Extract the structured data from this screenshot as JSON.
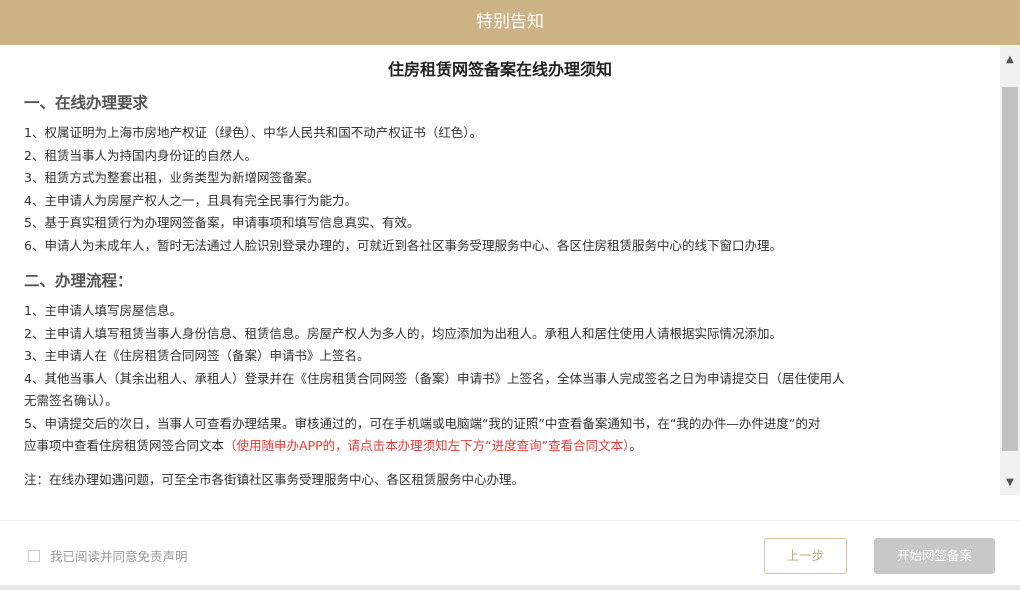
{
  "modal": {
    "title": "特别告知"
  },
  "doc": {
    "title": "住房租赁网签备案在线办理须知",
    "section1": {
      "title": "一、在线办理要求",
      "items": [
        "1、权属证明为上海市房地产权证（绿色）、中华人民共和国不动产权证书（红色）。",
        "2、租赁当事人为持国内身份证的自然人。",
        "3、租赁方式为整套出租，业务类型为新增网签备案。",
        "4、主申请人为房屋产权人之一，且具有完全民事行为能力。",
        "5、基于真实租赁行为办理网签备案，申请事项和填写信息真实、有效。",
        "6、申请人为未成年人，暂时无法通过人脸识别登录办理的，可就近到各社区事务受理服务中心、各区住房租赁服务中心的线下窗口办理。"
      ]
    },
    "section2": {
      "title": "二、办理流程：",
      "items": [
        "1、主申请人填写房屋信息。",
        "2、主申请人填写租赁当事人身份信息、租赁信息。房屋产权人为多人的，均应添加为出租人。承租人和居住使用人请根据实际情况添加。",
        "3、主申请人在《住房租赁合同网签（备案）申请书》上签名。",
        "4、其他当事人（其余出租人、承租人）登录并在《住房租赁合同网签（备案）申请书》上签名，全体当事人完成签名之日为申请提交日（居住使用人",
        "无需签名确认）。",
        "5、申请提交后的次日，当事人可查看办理结果。审核通过的，可在手机端或电脑端“我的证照”中查看备案通知书，在“我的办件—办件进度”的对"
      ],
      "item5_cont": "应事项中查看住房租赁网签合同文本",
      "item5_red": "（使用随申办APP的，请点击本办理须知左下方“进度查询”查看合同文本）",
      "item5_end": "。"
    },
    "note": "注：在线办理如遇问题，可至全市各街镇社区事务受理服务中心、各区租赁服务中心办理。"
  },
  "footer": {
    "agree_label": "我已阅读并同意免责声明",
    "agree_checked": false,
    "prev_label": "上一步",
    "start_label": "开始网签备案"
  },
  "icons": {
    "up": "arrow-up-icon",
    "down": "arrow-down-icon"
  },
  "colors": {
    "header_bg": "#cdb285",
    "note_red": "#e53935",
    "prev_border": "#d8c39b",
    "start_disabled": "#c8c8c8"
  }
}
